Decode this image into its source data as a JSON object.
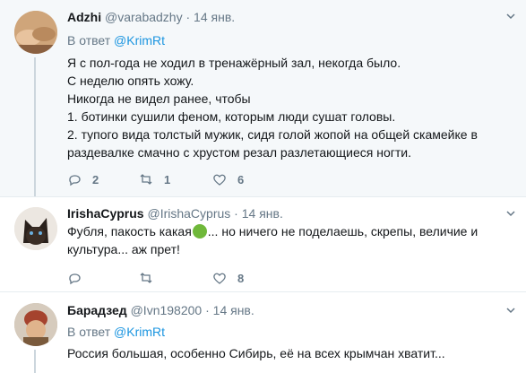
{
  "tweets": [
    {
      "name": "Adzhi",
      "handle": "@varabadzhy",
      "time": "14 янв.",
      "reply_prefix": "В ответ",
      "reply_handle": "@KrimRt",
      "lines": [
        "Я с пол-года не ходил в тренажёрный зал, некогда было.",
        "С неделю опять хожу.",
        "Никогда не видел ранее, чтобы",
        "1. ботинки сушили феном, которым люди сушат головы.",
        "2. тупого вида толстый мужик, сидя голой жопой на общей скамейке в",
        "раздевалке смачно с хрустом резал разлетающиеся ногти."
      ],
      "replies": "2",
      "retweets": "1",
      "likes": "6"
    },
    {
      "name": "IrishaCyprus",
      "handle": "@IrishaCyprus",
      "time": "14 янв.",
      "line1_a": "Фубля, пакость какая",
      "line1_b": "... но ничего не поделаешь, скрепы, величие и",
      "line2": "культура... аж прет!",
      "replies": "",
      "retweets": "",
      "likes": "8"
    },
    {
      "name": "Барадзед",
      "handle": "@Ivn198200",
      "time": "14 янв.",
      "reply_prefix": "В ответ",
      "reply_handle": "@KrimRt",
      "line1": "Россия большая, особенно Сибирь, её на всех крымчан хватит..."
    }
  ],
  "icons": [
    "caret-down-icon",
    "reply-icon",
    "retweet-icon",
    "like-icon",
    "sick-face-emoji"
  ],
  "colors": {
    "link": "#1b95e0",
    "muted": "#657786",
    "highlight_bg": "#f5f8fa",
    "thread_line": "#ccd6dd"
  }
}
